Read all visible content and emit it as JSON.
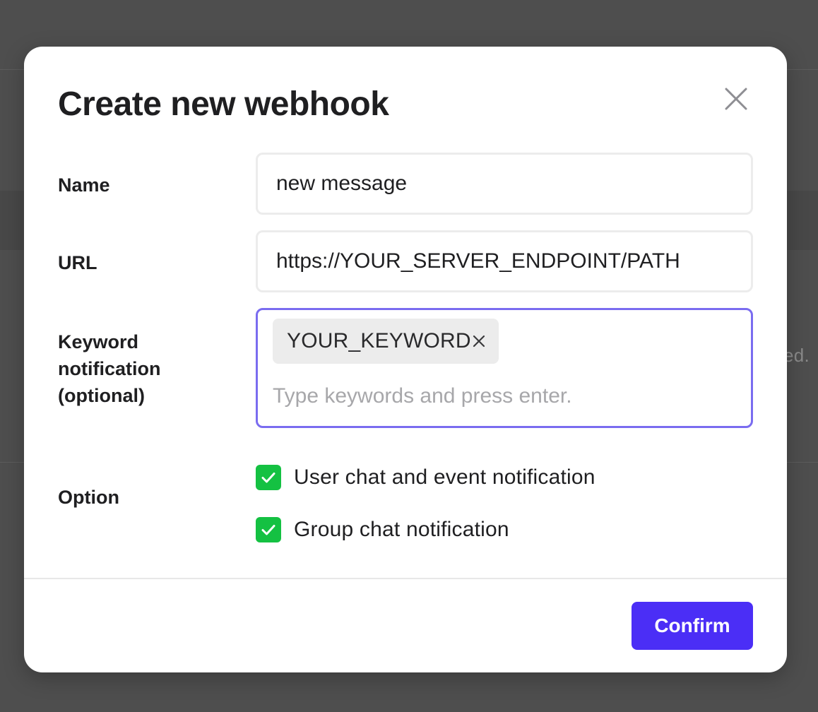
{
  "background": {
    "partial_text": "ed."
  },
  "modal": {
    "title": "Create new webhook",
    "close_icon": "close-icon",
    "fields": {
      "name": {
        "label": "Name",
        "value": "new message"
      },
      "url": {
        "label": "URL",
        "value": "https://YOUR_SERVER_ENDPOINT/PATH"
      },
      "keyword": {
        "label_line1": "Keyword",
        "label_line2": "notification",
        "label_line3": "(optional)",
        "chips": [
          "YOUR_KEYWORD"
        ],
        "placeholder": "Type keywords and press enter."
      },
      "option": {
        "label": "Option",
        "items": [
          {
            "label": "User chat and event notification",
            "checked": true
          },
          {
            "label": "Group chat notification",
            "checked": true
          }
        ]
      }
    },
    "confirm_label": "Confirm"
  },
  "colors": {
    "accent": "#4b2ef6",
    "focus_border": "#7a6cf0",
    "checkbox_green": "#14c142",
    "overlay": "#4e4e4e"
  }
}
